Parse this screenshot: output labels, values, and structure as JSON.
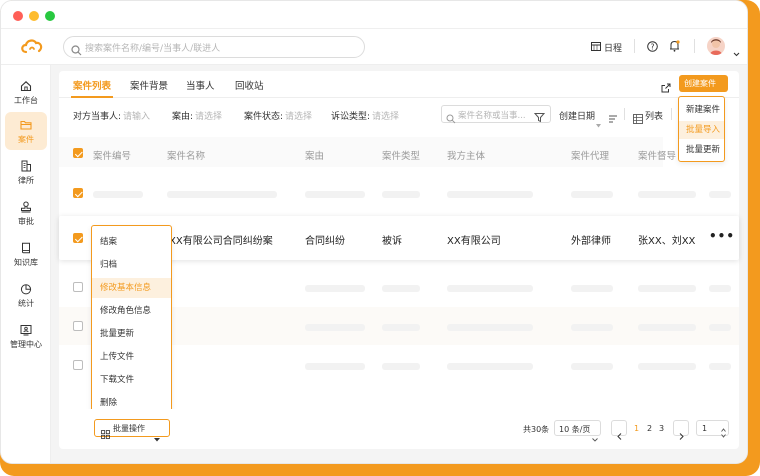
{
  "colors": {
    "accent": "#f39a1e",
    "window_dots": [
      "#ff5f57",
      "#febc2e",
      "#28c840"
    ]
  },
  "header": {
    "search_placeholder": "搜索案件名称/编号/当事人/联进人",
    "schedule_label": "日程",
    "icons": [
      "cloud-logo-icon",
      "search-icon",
      "calendar-icon",
      "help-icon",
      "bell-icon",
      "avatar",
      "chevron-down-icon"
    ]
  },
  "sidebar": {
    "items": [
      {
        "label": "工作台",
        "icon": "home-icon",
        "active": false
      },
      {
        "label": "案件",
        "icon": "folder-icon",
        "active": true
      },
      {
        "label": "律所",
        "icon": "building-icon",
        "active": false
      },
      {
        "label": "审批",
        "icon": "stamp-icon",
        "active": false
      },
      {
        "label": "知识库",
        "icon": "book-icon",
        "active": false
      },
      {
        "label": "统计",
        "icon": "pie-chart-icon",
        "active": false
      },
      {
        "label": "管理中心",
        "icon": "admin-icon",
        "active": false
      }
    ]
  },
  "tabs": [
    {
      "label": "案件列表",
      "active": true
    },
    {
      "label": "案件背景",
      "active": false
    },
    {
      "label": "当事人",
      "active": false
    },
    {
      "label": "回收站",
      "active": false
    }
  ],
  "create_button": {
    "label": "创建案件",
    "menu": [
      "新建案件",
      "批量导入",
      "批量更新"
    ],
    "highlighted_index": 1
  },
  "filters": {
    "opposing_party": {
      "label": "对方当事人:",
      "value": "请输入"
    },
    "cause": {
      "label": "案由:",
      "value": "请选择"
    },
    "status": {
      "label": "案件状态:",
      "value": "请选择"
    },
    "litigation_type": {
      "label": "诉讼类型:",
      "value": "请选择"
    },
    "search_placeholder": "案件名称或当事...",
    "sort_label": "创建日期",
    "view_label": "列表"
  },
  "table": {
    "columns": [
      "案件编号",
      "案件名称",
      "案由",
      "案件类型",
      "我方主体",
      "案件代理",
      "案件督导"
    ],
    "rows": [
      {
        "checked": true,
        "placeholder": true
      },
      {
        "checked": true,
        "placeholder": false,
        "name": "XX有限公司合同纠纷案",
        "cause": "合同纠纷",
        "type": "被诉",
        "entity": "XX有限公司",
        "agent": "外部律师",
        "supervisor": "张XX、刘XX",
        "more": "•••"
      },
      {
        "checked": false,
        "placeholder": true
      },
      {
        "checked": false,
        "placeholder": true
      },
      {
        "checked": false,
        "placeholder": true
      }
    ]
  },
  "batch": {
    "button_label": "批量操作",
    "menu": [
      "结案",
      "归档",
      "修改基本信息",
      "修改角色信息",
      "批量更新",
      "上传文件",
      "下载文件",
      "删除"
    ],
    "highlighted_index": 2
  },
  "pagination": {
    "total": "共30条",
    "page_size": "10 条/页",
    "pages": [
      "1",
      "2",
      "3"
    ],
    "current_page": "1",
    "jump_value": "1"
  }
}
